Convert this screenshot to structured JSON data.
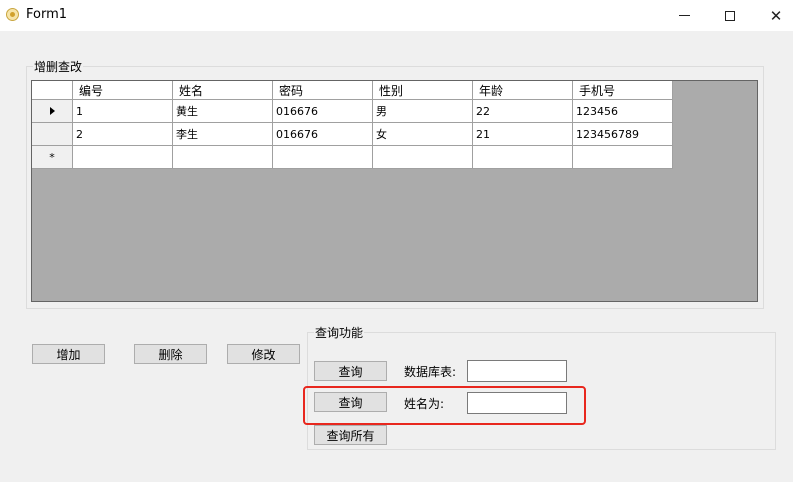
{
  "window": {
    "title": "Form1",
    "minimize": "—",
    "maximize": "□",
    "close": "✕"
  },
  "crud_group": {
    "title": "增删查改"
  },
  "grid": {
    "columns": [
      "编号",
      "姓名",
      "密码",
      "性别",
      "年龄",
      "手机号"
    ],
    "rows": [
      [
        "1",
        "黄生",
        "016676",
        "男",
        "22",
        "123456"
      ],
      [
        "2",
        "李生",
        "016676",
        "女",
        "21",
        "123456789"
      ]
    ],
    "new_row_marker": "*"
  },
  "buttons": {
    "add": "增加",
    "delete": "删除",
    "modify": "修改"
  },
  "query_group": {
    "title": "查询功能",
    "query_button_1": "查询",
    "db_table_label": "数据库表:",
    "db_table_value": "",
    "query_button_2": "查询",
    "name_label": "姓名为:",
    "name_value": "",
    "query_all_button": "查询所有"
  },
  "colors": {
    "highlight": "#e8271e",
    "grid_background": "#ababab"
  },
  "icons": {
    "app": "form-app-icon",
    "current_row": "row-pointer-icon"
  }
}
